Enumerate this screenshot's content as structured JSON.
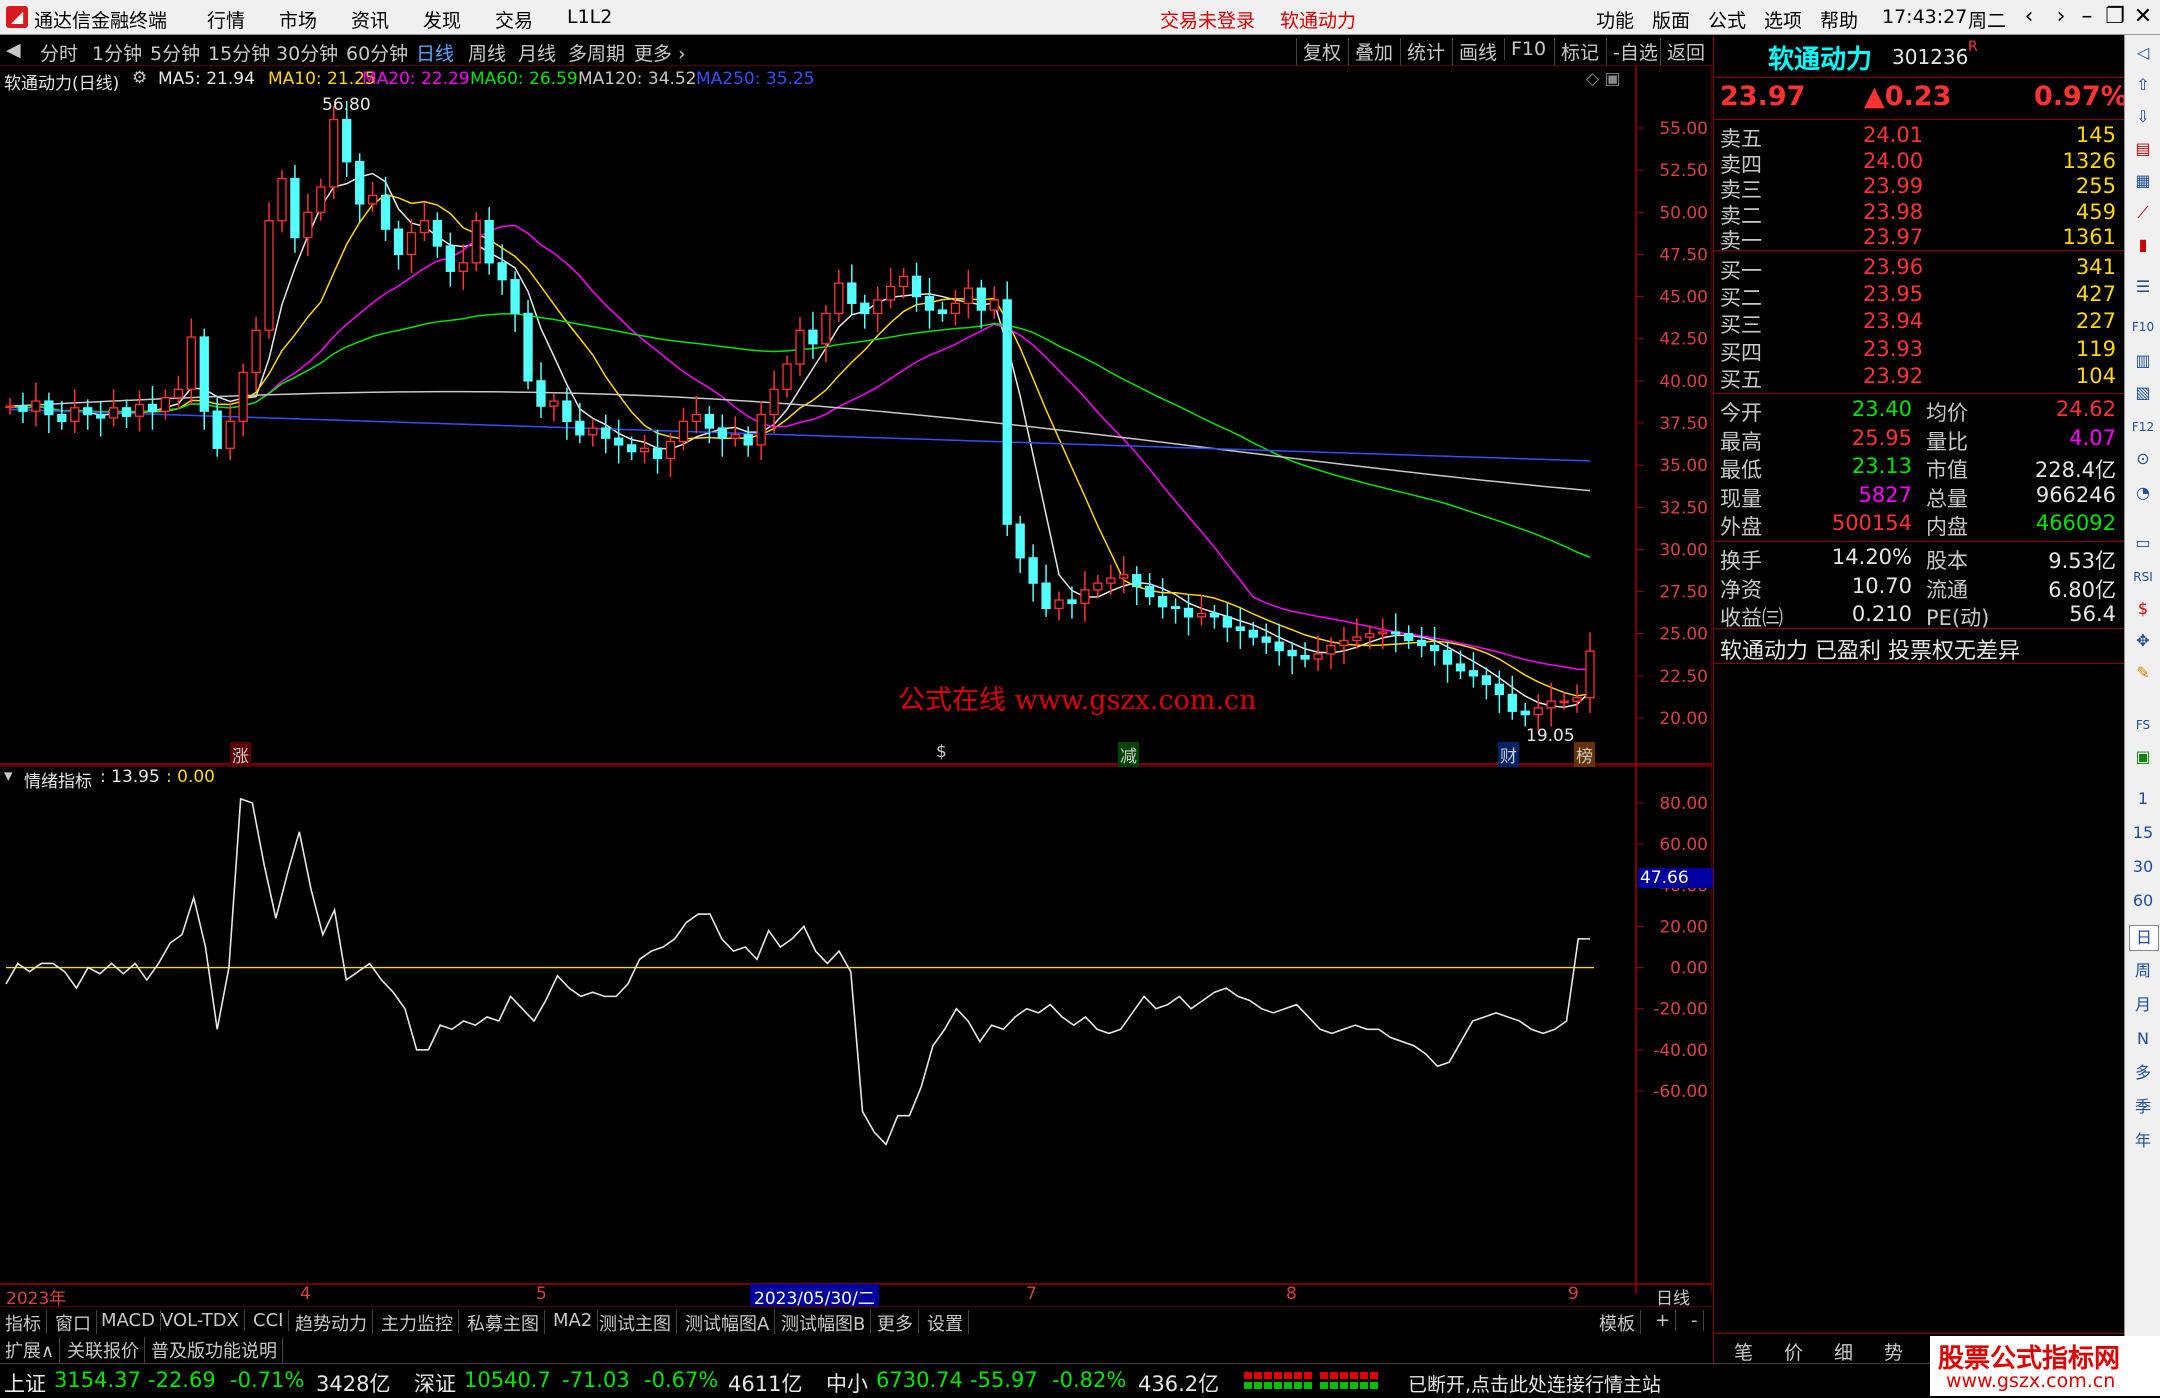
{
  "app": {
    "title": "通达信金融终端",
    "time": "17:43:27",
    "weekday": "周二"
  },
  "menu": [
    "行情",
    "市场",
    "资讯",
    "发现",
    "交易",
    "L1L2"
  ],
  "menu_status": [
    "交易未登录",
    "软通动力"
  ],
  "menu_right": [
    "功能",
    "版面",
    "公式",
    "选项",
    "帮助"
  ],
  "periods": [
    "分时",
    "1分钟",
    "5分钟",
    "15分钟",
    "30分钟",
    "60分钟",
    "日线",
    "周线",
    "月线",
    "多周期",
    "更多"
  ],
  "active_period": "日线",
  "toolbar_right": [
    "复权",
    "叠加",
    "统计",
    "画线",
    "F10",
    "标记",
    "-自选",
    "返回"
  ],
  "chart": {
    "name": "软通动力(日线)",
    "ma": [
      {
        "label": "MA5: 21.94",
        "color": "#e6e6e6"
      },
      {
        "label": "MA10: 21.25",
        "color": "#ffd700"
      },
      {
        "label": "MA20: 22.29",
        "color": "#ff00ff"
      },
      {
        "label": "MA60: 26.59",
        "color": "#00e600"
      },
      {
        "label": "MA120: 34.52",
        "color": "#c8c8c8"
      },
      {
        "label": "MA250: 35.25",
        "color": "#3050ff"
      }
    ],
    "price_ticks": [
      "55.00",
      "52.50",
      "50.00",
      "47.50",
      "45.00",
      "42.50",
      "40.00",
      "37.50",
      "35.00",
      "32.50",
      "30.00",
      "27.50",
      "25.00",
      "22.50",
      "20.00"
    ],
    "high_label": "56.80",
    "low_label": "19.05",
    "watermark": "公式在线  www.gszx.com.cn",
    "markers": [
      {
        "text": "涨",
        "color": "#ff3232"
      },
      {
        "text": "$",
        "color": "#ff3232"
      },
      {
        "text": "减",
        "color": "#00e600"
      },
      {
        "text": "财",
        "color": "#55aaff"
      },
      {
        "text": "榜",
        "color": "#ff9933"
      }
    ],
    "date_labels": [
      "2023年",
      "4",
      "5",
      "2023/05/30/二",
      "7",
      "8",
      "9"
    ],
    "period_label": "日线"
  },
  "indicator": {
    "name": "情绪指标",
    "value1": ": 13.95",
    "value2": ": 0.00",
    "ticks": [
      "80.00",
      "60.00",
      "40.00",
      "20.00",
      "0.00",
      "-20.00",
      "-40.00",
      "-60.00"
    ],
    "current": "47.66"
  },
  "chart_data": {
    "type": "line",
    "title": "情绪指标",
    "ylim": [
      -87,
      87
    ],
    "values": [
      -8,
      2,
      -2,
      2,
      2,
      -2,
      -10,
      0,
      -3,
      2,
      -3,
      2,
      -6,
      2,
      12,
      16,
      34,
      10,
      -30,
      0,
      82,
      80,
      50,
      24,
      46,
      66,
      38,
      16,
      28,
      -6,
      -2,
      2,
      -6,
      -12,
      -20,
      -40,
      -40,
      -28,
      -30,
      -26,
      -28,
      -24,
      -26,
      -14,
      -20,
      -26,
      -16,
      -4,
      -10,
      -14,
      -12,
      -14,
      -14,
      -8,
      4,
      8,
      10,
      14,
      22,
      26,
      26,
      14,
      8,
      10,
      4,
      18,
      10,
      14,
      20,
      8,
      2,
      8,
      -2,
      -70,
      -80,
      -86,
      -72,
      -72,
      -58,
      -38,
      -30,
      -20,
      -26,
      -36,
      -28,
      -30,
      -24,
      -20,
      -22,
      -18,
      -24,
      -28,
      -24,
      -30,
      -32,
      -30,
      -22,
      -14,
      -20,
      -18,
      -14,
      -20,
      -16,
      -12,
      -10,
      -14,
      -16,
      -20,
      -22,
      -20,
      -18,
      -24,
      -30,
      -32,
      -30,
      -28,
      -30,
      -30,
      -34,
      -36,
      -38,
      -42,
      -48,
      -46,
      -36,
      -26,
      -24,
      -22,
      -24,
      -26,
      -30,
      -32,
      -30,
      -26,
      14,
      13.95
    ]
  },
  "quote": {
    "name": "软通动力",
    "code": "301236",
    "flag": "R",
    "price": "23.97",
    "change": "▲0.23",
    "pct": "0.97%",
    "asks": [
      {
        "label": "卖五",
        "price": "24.01",
        "vol": "145"
      },
      {
        "label": "卖四",
        "price": "24.00",
        "vol": "1326"
      },
      {
        "label": "卖三",
        "price": "23.99",
        "vol": "255"
      },
      {
        "label": "卖二",
        "price": "23.98",
        "vol": "459"
      },
      {
        "label": "卖一",
        "price": "23.97",
        "vol": "1361"
      }
    ],
    "bids": [
      {
        "label": "买一",
        "price": "23.96",
        "vol": "341"
      },
      {
        "label": "买二",
        "price": "23.95",
        "vol": "427"
      },
      {
        "label": "买三",
        "price": "23.94",
        "vol": "227"
      },
      {
        "label": "买四",
        "price": "23.93",
        "vol": "119"
      },
      {
        "label": "买五",
        "price": "23.92",
        "vol": "104"
      }
    ],
    "stats1": [
      {
        "k1": "今开",
        "v1": "23.40",
        "c1": "green",
        "k2": "均价",
        "v2": "24.62",
        "c2": "red"
      },
      {
        "k1": "最高",
        "v1": "25.95",
        "c1": "red",
        "k2": "量比",
        "v2": "4.07",
        "c2": "mag"
      },
      {
        "k1": "最低",
        "v1": "23.13",
        "c1": "green",
        "k2": "市值",
        "v2": "228.4亿",
        "c2": "white"
      },
      {
        "k1": "现量",
        "v1": "5827",
        "c1": "mag",
        "k2": "总量",
        "v2": "966246",
        "c2": "white"
      },
      {
        "k1": "外盘",
        "v1": "500154",
        "c1": "red",
        "k2": "内盘",
        "v2": "466092",
        "c2": "green"
      }
    ],
    "stats2": [
      {
        "k1": "换手",
        "v1": "14.20%",
        "k2": "股本",
        "v2": "9.53亿"
      },
      {
        "k1": "净资",
        "v1": "10.70",
        "k2": "流通",
        "v2": "6.80亿"
      },
      {
        "k1": "收益㈢",
        "v1": "0.210",
        "k2": "PE(动)",
        "v2": "56.4"
      }
    ],
    "note": "软通动力 已盈利 投票权无差异",
    "bottom_tabs": [
      "笔",
      "价",
      "细",
      "势"
    ]
  },
  "side_tools": [
    "1",
    "15",
    "30",
    "60",
    "日",
    "周",
    "月",
    "N",
    "多",
    "季",
    "年"
  ],
  "tabs": [
    "指标",
    "窗口",
    "MACD",
    "VOL-TDX",
    "CCI",
    "趋势动力",
    "主力监控",
    "私募主图",
    "MA2",
    "测试主图",
    "测试幅图A",
    "测试幅图B",
    "更多",
    "设置"
  ],
  "tabs_right": [
    "模板",
    "+",
    "-"
  ],
  "tabs2": [
    "扩展∧",
    "关联报价",
    "普及版功能说明"
  ],
  "status": {
    "sh_name": "上证",
    "sh_val": "3154.37",
    "sh_chg": "-22.69",
    "sh_pct": "-0.71%",
    "sh_amt": "3428亿",
    "sz_name": "深证",
    "sz_val": "10540.7",
    "sz_chg": "-71.03",
    "sz_pct": "-0.67%",
    "sz_amt": "4611亿",
    "zx_name": "中小",
    "zx_val": "6730.74",
    "zx_chg": "-55.97",
    "zx_pct": "-0.82%",
    "zx_amt": "436.2亿",
    "conn": "已断开,点击此处连接行情主站",
    "brand": "股票公式指标网",
    "brand_url": "www.gszx.com.cn"
  }
}
